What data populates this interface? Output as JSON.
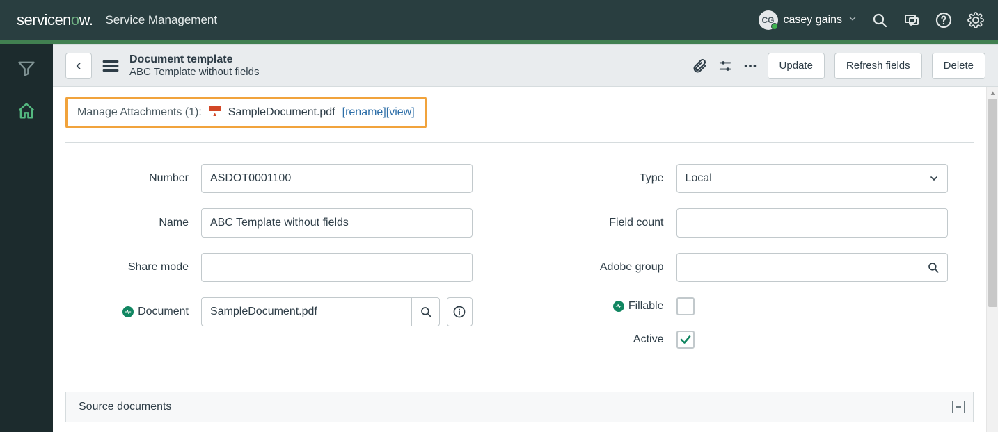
{
  "header": {
    "logo_prefix": "servicen",
    "logo_suffix": "w.",
    "app_title": "Service Management",
    "user_initials": "CG",
    "user_name": "casey gains"
  },
  "toolbar": {
    "title": "Document template",
    "subtitle": "ABC Template without fields",
    "update_label": "Update",
    "refresh_label": "Refresh fields",
    "delete_label": "Delete"
  },
  "attachments": {
    "label": "Manage Attachments (1):",
    "file_name": "SampleDocument.pdf",
    "rename_label": "[rename]",
    "view_label": "[view]"
  },
  "form": {
    "number_label": "Number",
    "number_value": "ASDOT0001100",
    "name_label": "Name",
    "name_value": "ABC Template without fields",
    "share_mode_label": "Share mode",
    "share_mode_value": "",
    "document_label": "Document",
    "document_value": "SampleDocument.pdf",
    "type_label": "Type",
    "type_value": "Local",
    "field_count_label": "Field count",
    "field_count_value": "",
    "adobe_group_label": "Adobe group",
    "adobe_group_value": "",
    "fillable_label": "Fillable",
    "active_label": "Active"
  },
  "section": {
    "title": "Source documents"
  }
}
